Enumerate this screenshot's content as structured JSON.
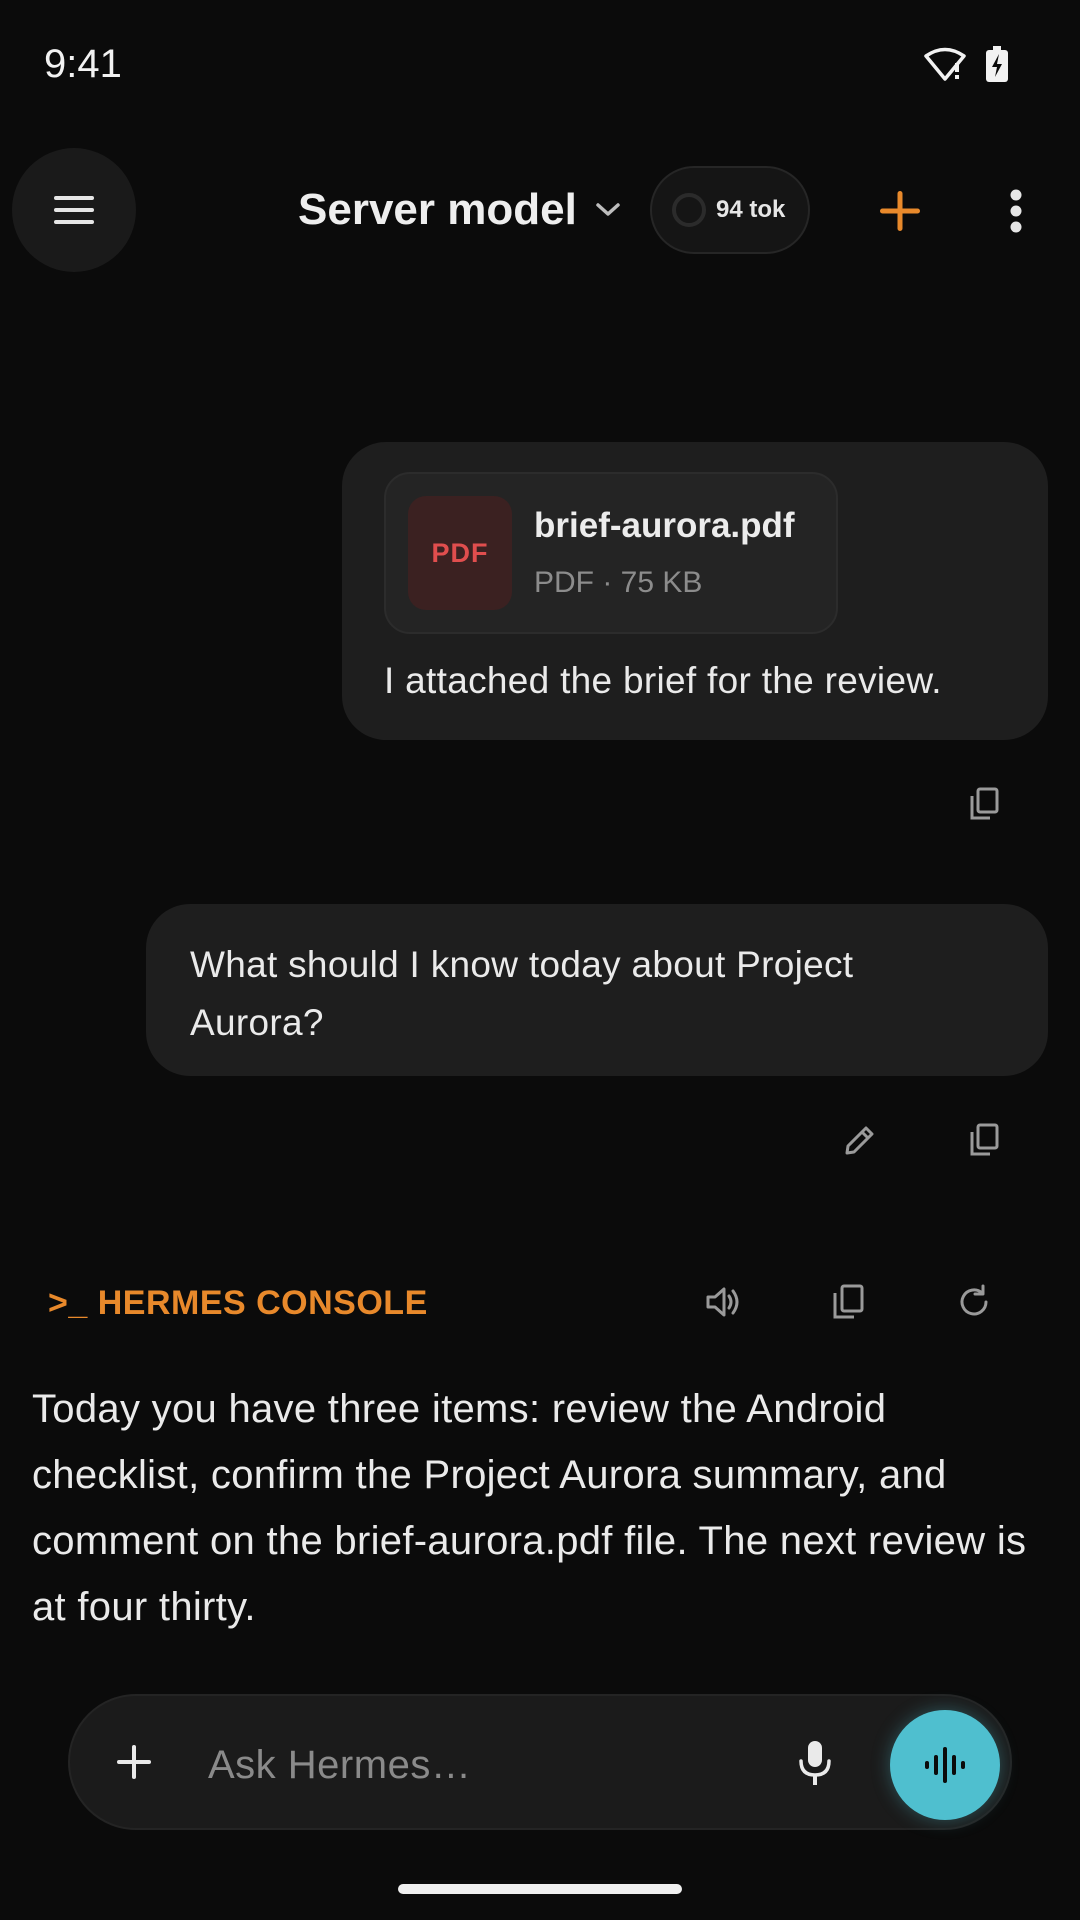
{
  "status_bar": {
    "time": "9:41"
  },
  "header": {
    "model_label": "Server model",
    "token_count": "94 tok"
  },
  "messages": [
    {
      "role": "user",
      "attachment": {
        "thumb_label": "PDF",
        "file_name": "brief-aurora.pdf",
        "meta": "PDF · 75 KB"
      },
      "text": "I attached the brief for the review."
    },
    {
      "role": "user",
      "text": "What should I know today about Project Aurora?"
    }
  ],
  "assistant": {
    "label": ">_ HERMES CONSOLE",
    "text": "Today you have three items: review the Android checklist, confirm the Project Aurora summary, and comment on the brief-aurora.pdf file. The next review is at four thirty."
  },
  "composer": {
    "placeholder": "Ask Hermes…"
  },
  "colors": {
    "accent": "#e8892b",
    "voice": "#4fbfcf",
    "pdf": "#e04e4e",
    "background": "#0b0b0b"
  },
  "icons": [
    "menu-icon",
    "chevron-down-icon",
    "plus-icon",
    "more-vert-icon",
    "copy-icon",
    "edit-icon",
    "speaker-icon",
    "refresh-icon",
    "mic-icon",
    "waveform-icon",
    "wifi-icon",
    "battery-icon"
  ]
}
